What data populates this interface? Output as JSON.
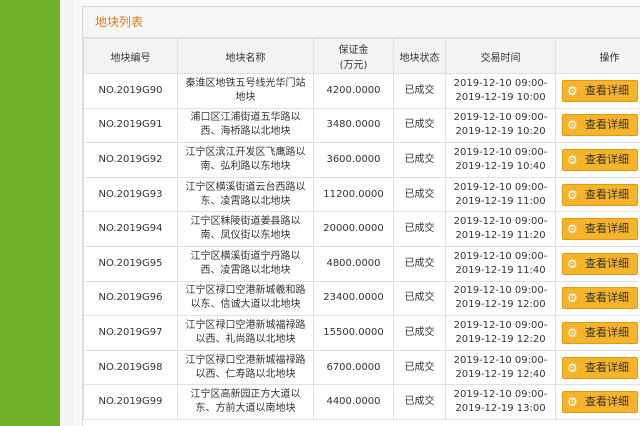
{
  "panel": {
    "title": "地块列表"
  },
  "table": {
    "headers": {
      "code": "地块编号",
      "name": "地块名称",
      "deposit_line1": "保证金",
      "deposit_line2": "(万元)",
      "status": "地块状态",
      "time": "交易时间",
      "action": "操作"
    },
    "rows": [
      {
        "code": "NO.2019G90",
        "name_l1": "秦淮区地铁五号线光华门站",
        "name_l2": "地块",
        "deposit": "4200.0000",
        "status": "已成交",
        "time_l1": "2019-12-10 09:00-",
        "time_l2": "2019-12-19 10:00",
        "action": "查看详细"
      },
      {
        "code": "NO.2019G91",
        "name_l1": "浦口区江浦街道五华路以",
        "name_l2": "西、海桥路以北地块",
        "deposit": "3480.0000",
        "status": "已成交",
        "time_l1": "2019-12-10 09:00-",
        "time_l2": "2019-12-19 10:20",
        "action": "查看详细"
      },
      {
        "code": "NO.2019G92",
        "name_l1": "江宁区滨江开发区飞鹰路以",
        "name_l2": "南、弘利路以东地块",
        "deposit": "3600.0000",
        "status": "已成交",
        "time_l1": "2019-12-10 09:00-",
        "time_l2": "2019-12-19 10:40",
        "action": "查看详细"
      },
      {
        "code": "NO.2019G93",
        "name_l1": "江宁区横溪街道云台西路以",
        "name_l2": "东、凌霄路以北地块",
        "deposit": "11200.0000",
        "status": "已成交",
        "time_l1": "2019-12-10 09:00-",
        "time_l2": "2019-12-19 11:00",
        "action": "查看详细"
      },
      {
        "code": "NO.2019G94",
        "name_l1": "江宁区秣陵街道姜县路以",
        "name_l2": "南、凤仪街以东地块",
        "deposit": "20000.0000",
        "status": "已成交",
        "time_l1": "2019-12-10 09:00-",
        "time_l2": "2019-12-19 11:20",
        "action": "查看详细"
      },
      {
        "code": "NO.2019G95",
        "name_l1": "江宁区横溪街道宁丹路以",
        "name_l2": "西、凌霄路以北地块",
        "deposit": "4800.0000",
        "status": "已成交",
        "time_l1": "2019-12-10 09:00-",
        "time_l2": "2019-12-19 11:40",
        "action": "查看详细"
      },
      {
        "code": "NO.2019G96",
        "name_l1": "江宁区禄口空港新城羲和路",
        "name_l2": "以东、信诚大道以北地块",
        "deposit": "23400.0000",
        "status": "已成交",
        "time_l1": "2019-12-10 09:00-",
        "time_l2": "2019-12-19 12:00",
        "action": "查看详细"
      },
      {
        "code": "NO.2019G97",
        "name_l1": "江宁区禄口空港新城福禄路",
        "name_l2": "以西、礼尚路以北地块",
        "deposit": "15500.0000",
        "status": "已成交",
        "time_l1": "2019-12-10 09:00-",
        "time_l2": "2019-12-19 12:20",
        "action": "查看详细"
      },
      {
        "code": "NO.2019G98",
        "name_l1": "江宁区禄口空港新城福禄路",
        "name_l2": "以西、仁寿路以北地块",
        "deposit": "6700.0000",
        "status": "已成交",
        "time_l1": "2019-12-10 09:00-",
        "time_l2": "2019-12-19 12:40",
        "action": "查看详细"
      },
      {
        "code": "NO.2019G99",
        "name_l1": "江宁区高新园正方大道以",
        "name_l2": "东、方前大道以南地块",
        "deposit": "4400.0000",
        "status": "已成交",
        "time_l1": "2019-12-10 09:00-",
        "time_l2": "2019-12-19 13:00",
        "action": "查看详细"
      }
    ]
  },
  "colors": {
    "side_bar": "#6fb02a",
    "title_text": "#e07b1e",
    "button_bg": "#f5b42a"
  },
  "icons": {
    "action_button_icon": "gear-icon"
  }
}
